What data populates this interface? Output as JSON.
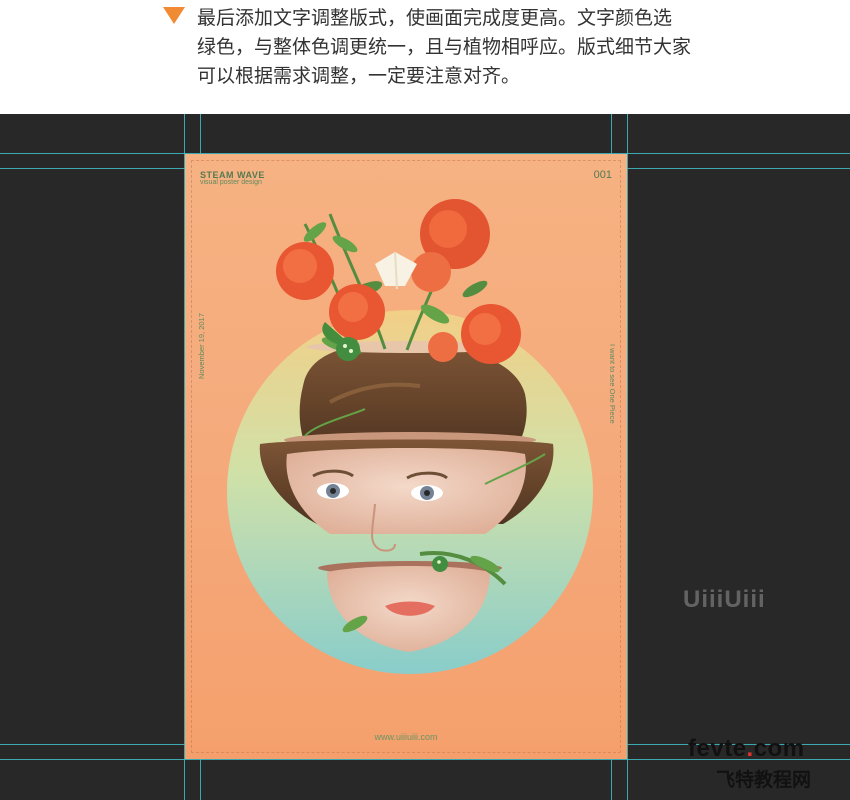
{
  "instruction": {
    "lines": [
      "最后添加文字调整版式，使画面完成度更高。文字颜色选",
      "绿色，与整体色调更统一，且与植物相呼应。版式细节大家",
      "可以根据需求调整，一定要注意对齐。"
    ],
    "accent_color": "#f08a33"
  },
  "poster": {
    "brand": "STEAM  WAVE",
    "subtitle": "visual poster design",
    "number": "001",
    "date_vertical": "November 19, 2017",
    "quote_vertical": "I want to see One Piece",
    "url": "www.uiiiuiii.com",
    "text_color": "#557a52"
  },
  "watermarks": {
    "logo": "UiiiUiii",
    "site_name": "fevte",
    "site_dot": ".",
    "site_tld": "com",
    "site_cn": "飞特教程网"
  },
  "colors": {
    "canvas": "#282828",
    "guide": "#3fbfc9",
    "poster_bg": "#f6ae7c"
  }
}
